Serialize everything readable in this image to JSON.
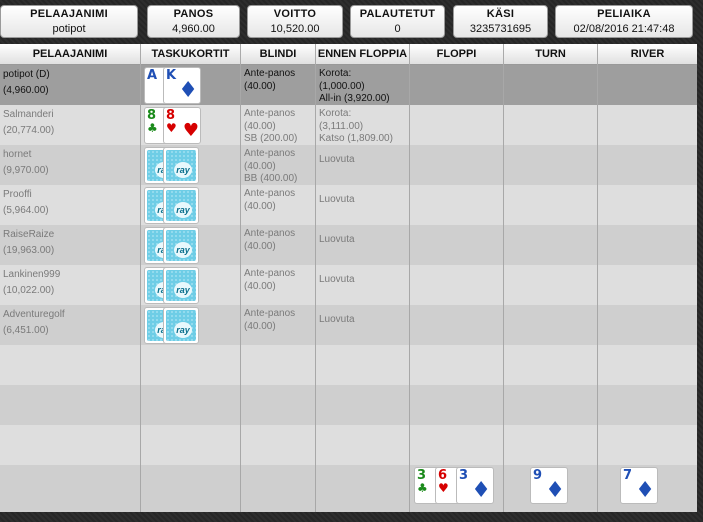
{
  "summary": [
    {
      "label": "PELAAJANIMI",
      "value": "potipot"
    },
    {
      "label": "PANOS",
      "value": "4,960.00"
    },
    {
      "label": "VOITTO",
      "value": "10,520.00"
    },
    {
      "label": "PALAUTETUT",
      "value": "0"
    },
    {
      "label": "KÄSI",
      "value": "3235731695"
    },
    {
      "label": "PELIAIKA",
      "value": "02/08/2016 21:47:48"
    }
  ],
  "columns": [
    "PELAAJANIMI",
    "TASKUKORTIT",
    "BLINDI",
    "ENNEN FLOPPIA",
    "FLOPPI",
    "TURN",
    "RIVER"
  ],
  "players": [
    {
      "name": "potipot (D)",
      "stack": "(4,960.00)",
      "blind": [
        "Ante-panos",
        "(40.00)"
      ],
      "preflop": [
        "Korota:",
        "(1,000.00)",
        "All-in (3,920.00)"
      ]
    },
    {
      "name": "Salmanderi",
      "stack": "(20,774.00)",
      "blind": [
        "Ante-panos",
        "(40.00)",
        "SB (200.00)"
      ],
      "preflop": [
        "Korota:",
        "(3,111.00)",
        "Katso (1,809.00)"
      ]
    },
    {
      "name": "hornet",
      "stack": "(9,970.00)",
      "blind": [
        "Ante-panos",
        "(40.00)",
        "BB (400.00)"
      ],
      "preflop": [
        "Luovuta"
      ]
    },
    {
      "name": "Prooffi",
      "stack": "(5,964.00)",
      "blind": [
        "Ante-panos",
        "(40.00)"
      ],
      "preflop": [
        "Luovuta"
      ]
    },
    {
      "name": "RaiseRaize",
      "stack": "(19,963.00)",
      "blind": [
        "Ante-panos",
        "(40.00)"
      ],
      "preflop": [
        "Luovuta"
      ]
    },
    {
      "name": "Lankinen999",
      "stack": "(10,022.00)",
      "blind": [
        "Ante-panos",
        "(40.00)"
      ],
      "preflop": [
        "Luovuta"
      ]
    },
    {
      "name": "Adventuregolf",
      "stack": "(6,451.00)",
      "blind": [
        "Ante-panos",
        "(40.00)"
      ],
      "preflop": [
        "Luovuta"
      ]
    }
  ],
  "cards": {
    "hero": [
      {
        "rank": "A",
        "suit": "♦",
        "color": "blue"
      },
      {
        "rank": "K",
        "suit": "♦",
        "color": "blue"
      }
    ],
    "villain": [
      {
        "rank": "8",
        "suit": "♣",
        "color": "green"
      },
      {
        "rank": "8",
        "suit": "♥",
        "color": "red"
      }
    ],
    "back_logo": "ray",
    "flop": [
      {
        "rank": "3",
        "suit": "♣",
        "color": "green"
      },
      {
        "rank": "6",
        "suit": "♥",
        "color": "red"
      },
      {
        "rank": "3",
        "suit": "♦",
        "color": "blue"
      }
    ],
    "turn": {
      "rank": "9",
      "suit": "♦",
      "color": "blue"
    },
    "river": {
      "rank": "7",
      "suit": "♦",
      "color": "blue"
    }
  },
  "colors": {
    "red": "#d60000",
    "blue": "#1f4fb5",
    "green": "#1a8a1a",
    "hero_row": "#9e9e9e"
  }
}
